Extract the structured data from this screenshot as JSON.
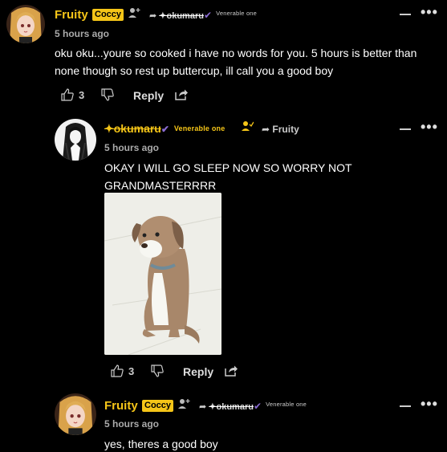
{
  "comments": [
    {
      "author": "Fruity",
      "badge": "Coccy",
      "reply_to": "✦okumaru",
      "reply_to_rank": "Venerable one",
      "time": "5 hours ago",
      "text": "oku oku...youre so cooked i have no words for you. 5 hours is better than none though so rest up buttercup, ill call you a good boy",
      "likes": "3",
      "reply_label": "Reply"
    },
    {
      "author": "✦okumaru",
      "author_rank": "Venerable one",
      "reply_to": "Fruity",
      "time": "5 hours ago",
      "text": "OKAY I WILL GO SLEEP NOW SO WORRY NOT GRANDMASTERRRR",
      "likes": "3",
      "reply_label": "Reply"
    },
    {
      "author": "Fruity",
      "badge": "Coccy",
      "reply_to": "✦okumaru",
      "reply_to_rank": "Venerable one",
      "time": "5 hours ago",
      "text": "yes, theres a good boy"
    }
  ],
  "icons": {
    "avatar_anime_girl": "anime-girl-avatar",
    "avatar_dark_hair": "dark-hair-avatar",
    "follow": "person-plus-icon",
    "reply_arrow": "share-arrow-icon",
    "like": "thumbs-up-icon",
    "dislike": "thumbs-down-icon",
    "share": "share-box-icon",
    "collapse": "collapse-dash-icon",
    "more": "more-dots-icon",
    "verified": "check-icon"
  },
  "colors": {
    "background": "#000000",
    "name_gold": "#f5c518",
    "badge_bg": "#f5c518",
    "check_purple": "#8a6bd1"
  }
}
